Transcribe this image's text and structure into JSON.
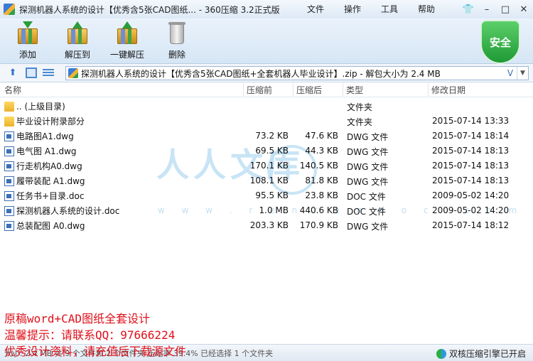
{
  "window": {
    "title": "探测机器人系统的设计【优秀含5张CAD图纸... - 360压缩 3.2正式版"
  },
  "menu": [
    "文件",
    "操作",
    "工具",
    "帮助"
  ],
  "toolbar": {
    "add": "添加",
    "extract_to": "解压到",
    "one_click": "一键解压",
    "delete": "删除"
  },
  "security_badge": "安全",
  "address": {
    "path": "探测机器人系统的设计【优秀含5张CAD图纸+全套机器人毕业设计】.zip - 解包大小为 2.4 MB",
    "v_glyph": "V",
    "dropdown": "▼"
  },
  "columns": {
    "name": "名称",
    "compressed": "压缩前",
    "after": "压缩后",
    "type": "类型",
    "modified": "修改日期"
  },
  "files": [
    {
      "name": ".. (上级目录)",
      "before": "",
      "after": "",
      "type": "文件夹",
      "date": "",
      "icon": "folder"
    },
    {
      "name": "毕业设计附录部分",
      "before": "",
      "after": "",
      "type": "文件夹",
      "date": "2015-07-14 13:33",
      "icon": "folder"
    },
    {
      "name": "电路图A1.dwg",
      "before": "73.2 KB",
      "after": "47.6 KB",
      "type": "DWG 文件",
      "date": "2015-07-14 18:14",
      "icon": "file"
    },
    {
      "name": "电气图 A1.dwg",
      "before": "69.5 KB",
      "after": "44.3 KB",
      "type": "DWG 文件",
      "date": "2015-07-14 18:13",
      "icon": "file"
    },
    {
      "name": "行走机构A0.dwg",
      "before": "170.1 KB",
      "after": "140.5 KB",
      "type": "DWG 文件",
      "date": "2015-07-14 18:13",
      "icon": "file"
    },
    {
      "name": "履带装配 A1.dwg",
      "before": "108.1 KB",
      "after": "81.8 KB",
      "type": "DWG 文件",
      "date": "2015-07-14 18:13",
      "icon": "file"
    },
    {
      "name": "任务书+目录.doc",
      "before": "95.5 KB",
      "after": "23.8 KB",
      "type": "DOC 文件",
      "date": "2009-05-02 14:20",
      "icon": "file"
    },
    {
      "name": "探测机器人系统的设计.doc",
      "before": "1.0 MB",
      "after": "440.6 KB",
      "type": "DOC 文件",
      "date": "2009-05-02 14:20",
      "icon": "file"
    },
    {
      "name": "总装配图 A0.dwg",
      "before": "203.3 KB",
      "after": "170.9 KB",
      "type": "DWG 文件",
      "date": "2015-07-14 18:12",
      "icon": "file"
    }
  ],
  "watermark": {
    "big": "人人文库",
    "url": "w w w . r e n r e n d o c . c o m"
  },
  "promo": [
    "原稿word+CAD图纸全套设计",
    "温馨提示：请联系QQ：97666224",
    "优秀设计资料，请充值后下载源文件"
  ],
  "status": {
    "left": "大小: 2.4 MB 共 9 个文件和 2 个文件夹 压缩率 39.4% 已经选择 1 个文件夹",
    "right": "双核压缩引擎已开启"
  },
  "colors": {
    "promo_red": "#e0101a",
    "accent_blue": "#3b6fb7",
    "shield_green": "#1e9a35"
  }
}
